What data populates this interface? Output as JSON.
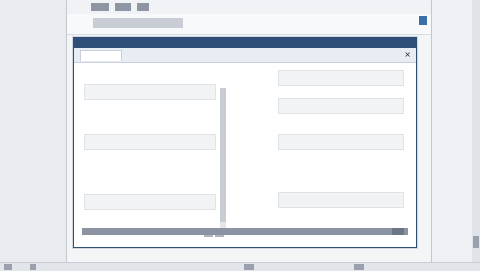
{
  "browser": {
    "tabstrip_label": "",
    "address_value": "",
    "close_symbol": ""
  },
  "dialog": {
    "title": "",
    "tabs": [
      "",
      "",
      ""
    ],
    "close_symbol": "×",
    "left_fields": [
      {
        "label": "",
        "value": ""
      },
      {
        "label": "",
        "value": ""
      },
      {
        "label": "",
        "value": ""
      },
      {
        "label": "",
        "value": ""
      }
    ],
    "right_fields": [
      {
        "label": "",
        "value": ""
      },
      {
        "label": "",
        "value": ""
      },
      {
        "label": "",
        "value": ""
      },
      {
        "label": "",
        "value": ""
      }
    ]
  },
  "colors": {
    "dialog_header": "#2f4f78",
    "accent_text": "#6f86b8"
  },
  "icons": [
    "close-icon",
    "scroll-thumb"
  ]
}
